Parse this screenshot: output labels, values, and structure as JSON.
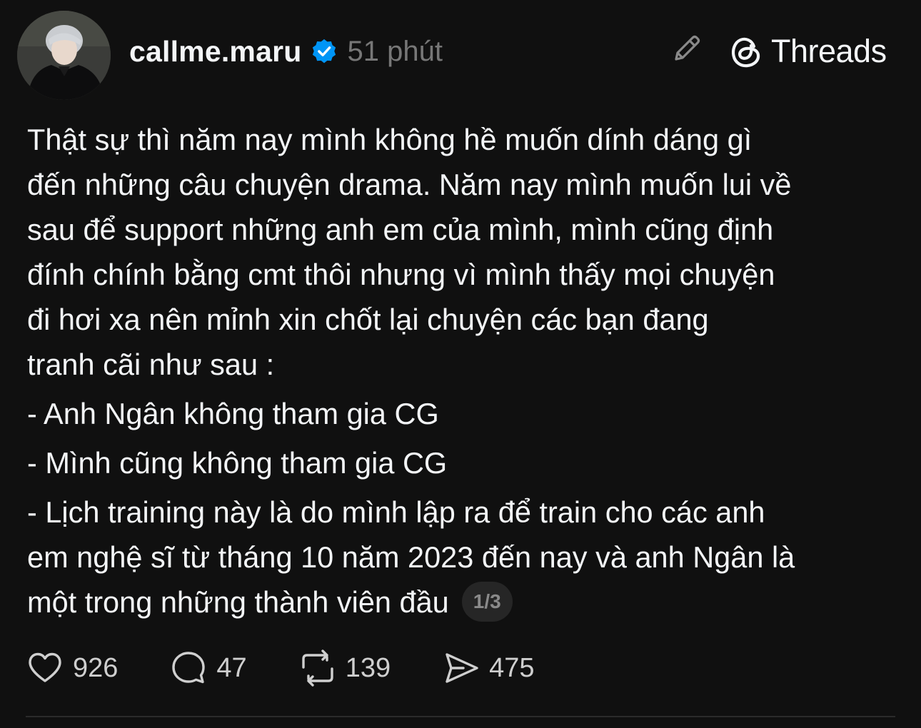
{
  "post": {
    "username": "callme.maru",
    "timestamp": "51 phút",
    "brand": "Threads",
    "paragraph_lines": [
      "Thật sự thì năm nay mình không hề muốn dính dáng gì",
      "đến những câu chuyện drama. Năm nay mình muốn lui về",
      "sau để support những anh em của mình, mình cũng định",
      "đính chính bằng cmt thôi nhưng vì mình thấy mọi chuyện",
      "đi hơi xa nên mỉnh xin chốt lại chuyện các bạn đang",
      "tranh cãi như sau :"
    ],
    "bullets": [
      "- Anh Ngân không tham gia CG",
      "- Mình cũng không tham gia CG"
    ],
    "last_bullet_lines": [
      "- Lịch training này là do mình lập ra để train cho các anh",
      "em nghệ sĩ từ tháng 10 năm 2023 đến nay và anh Ngân là",
      "một trong những thành viên đầu"
    ],
    "page_indicator": "1/3"
  },
  "actions": {
    "likes": "926",
    "comments": "47",
    "reposts": "139",
    "shares": "475"
  },
  "icons": {
    "verified": "verified-badge-icon",
    "edit": "pencil-icon",
    "brand": "threads-logo-icon",
    "like": "heart-icon",
    "comment": "comment-bubble-icon",
    "repost": "repost-icon",
    "share": "send-icon"
  },
  "colors": {
    "background": "#101010",
    "text": "#f3f5f7",
    "muted": "#777777",
    "verified": "#0095f6"
  }
}
